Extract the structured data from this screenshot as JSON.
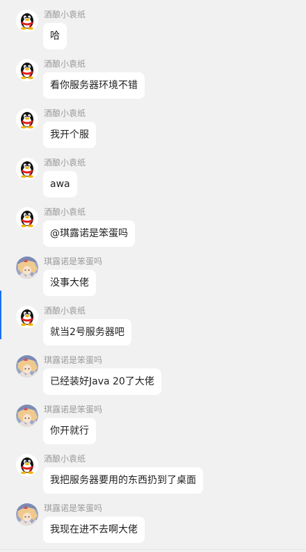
{
  "chat": {
    "messages": [
      {
        "sender": "酒酿小袁纸",
        "text": "哈",
        "avatar_icon": "qq-penguin-avatar"
      },
      {
        "sender": "酒酿小袁纸",
        "text": "看你服务器环境不错",
        "avatar_icon": "qq-penguin-avatar"
      },
      {
        "sender": "酒酿小袁纸",
        "text": "我开个服",
        "avatar_icon": "qq-penguin-avatar"
      },
      {
        "sender": "酒酿小袁纸",
        "text": "awa",
        "avatar_icon": "qq-penguin-avatar"
      },
      {
        "sender": "酒酿小袁纸",
        "text": "@琪露诺是笨蛋吗",
        "avatar_icon": "qq-penguin-avatar"
      },
      {
        "sender": "琪露诺是笨蛋吗",
        "text": "没事大佬",
        "avatar_icon": "anime-girl-avatar"
      },
      {
        "sender": "酒酿小袁纸",
        "text": "就当2号服务器吧",
        "avatar_icon": "qq-penguin-avatar"
      },
      {
        "sender": "琪露诺是笨蛋吗",
        "text": "已经装好Java 20了大佬",
        "avatar_icon": "anime-girl-avatar"
      },
      {
        "sender": "琪露诺是笨蛋吗",
        "text": "你开就行",
        "avatar_icon": "anime-girl-avatar"
      },
      {
        "sender": "酒酿小袁纸",
        "text": "我把服务器要用的东西扔到了桌面",
        "avatar_icon": "qq-penguin-avatar"
      },
      {
        "sender": "琪露诺是笨蛋吗",
        "text": "我现在进不去啊大佬",
        "avatar_icon": "anime-girl-avatar"
      }
    ]
  },
  "colors": {
    "background": "#f1f1f1",
    "bubble": "#ffffff",
    "sender_text": "#9a9a9a",
    "message_text": "#1f1f1f",
    "accent": "#1b6ff2"
  }
}
